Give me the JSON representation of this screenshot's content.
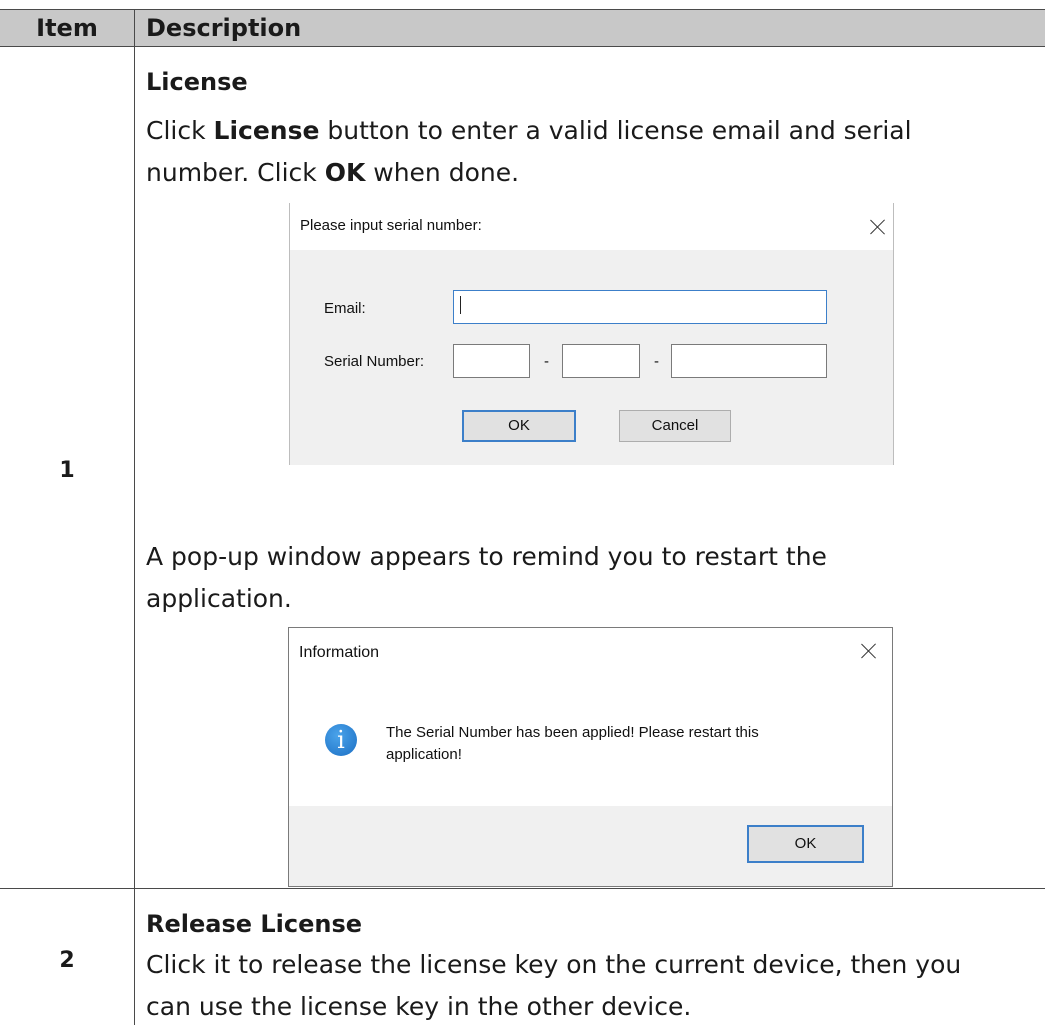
{
  "table": {
    "header": {
      "item": "Item",
      "description": "Description"
    },
    "rows": [
      {
        "item": "1",
        "title": "License",
        "line1_pre": "Click ",
        "line1_bold": "License",
        "line1_post": " button to enter a valid license email and serial",
        "line2_pre": "number. Click ",
        "line2_bold": "OK",
        "line2_post": " when done.",
        "after_dialog_line1": "A pop-up window appears to remind you to restart the",
        "after_dialog_line2": "application."
      },
      {
        "item": "2",
        "title": "Release License",
        "line1": "Click it to release the license key on the current device, then you",
        "line2": "can use the license key in the other device."
      }
    ]
  },
  "serial_dialog": {
    "title": "Please input serial number:",
    "email_label": "Email:",
    "email_value": "",
    "serial_label": "Serial Number:",
    "separator": "-",
    "ok_label": "OK",
    "cancel_label": "Cancel"
  },
  "info_dialog": {
    "title": "Information",
    "message_line1": "The Serial Number has been applied! Please restart this",
    "message_line2": "application!",
    "icon": "info-icon",
    "ok_label": "OK"
  }
}
